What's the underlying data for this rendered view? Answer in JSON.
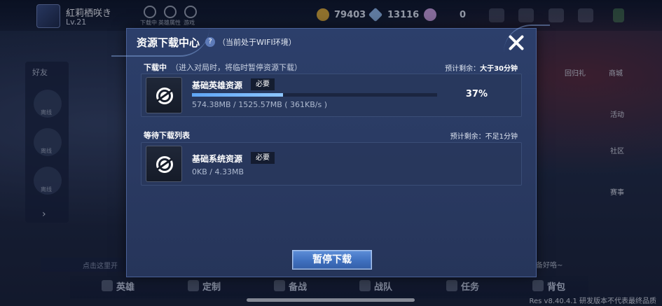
{
  "background": {
    "player": {
      "name": "紅莉栖咲き",
      "level": "Lv.21"
    },
    "top_icons": [
      {
        "label": "下载中",
        "icon": "download-icon"
      },
      {
        "label": "英雄属性",
        "icon": "target-icon"
      },
      {
        "label": "游戏",
        "icon": "crosshair-icon"
      }
    ],
    "currencies": [
      {
        "icon": "gold-coin-icon",
        "value": "79403",
        "color": "#d9a93a"
      },
      {
        "icon": "diamond-icon",
        "value": "13116",
        "color": "#8fb7e8"
      },
      {
        "icon": "voucher-icon",
        "value": "0",
        "color": "#c9a0e0"
      }
    ],
    "friends_label": "好友",
    "friend_status": [
      "离线",
      "离线",
      "离线"
    ],
    "right_menu": [
      "回归礼",
      "商城",
      "活动",
      "社区",
      "赛事"
    ],
    "bottom_nav": [
      "英雄",
      "定制",
      "备战",
      "战队",
      "任务",
      "背包"
    ],
    "chat_placeholder": "点击这里开",
    "chat_right": "利已准备好咯~",
    "version": "Res v8.40.4.1 研发版本不代表最终品质"
  },
  "modal": {
    "title": "资源下载中心",
    "help": "?",
    "subtitle": "（当前处于WIFI环境）",
    "downloading": {
      "title": "下载中",
      "note": "（进入对局时，将临时暂停资源下载）",
      "eta_label": "预计剩余：",
      "eta_value": "大于30分钟",
      "item": {
        "name": "基础英雄资源",
        "badge": "必要",
        "size": "574.38MB / 1525.57MB ( 361KB/s )",
        "percent": "37%",
        "progress": 0.37
      }
    },
    "queue": {
      "title": "等待下载列表",
      "eta_label": "预计剩余：",
      "eta_value": "不足1分钟",
      "item": {
        "name": "基础系统资源",
        "badge": "必要",
        "size": "0KB / 4.33MB"
      }
    },
    "pause_label": "暂停下载"
  }
}
